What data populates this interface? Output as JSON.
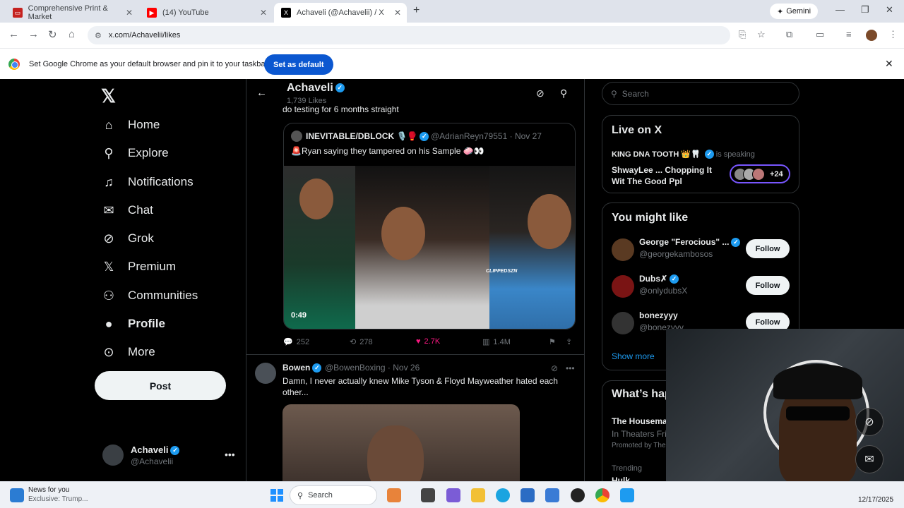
{
  "browser": {
    "tabs": [
      {
        "title": "Comprehensive Print & Market",
        "color": "#c5221f"
      },
      {
        "title": "(14) YouTube",
        "color": "#ff0000"
      },
      {
        "title": "Achaveli (@Achavelii) / X",
        "color": "#000000"
      }
    ],
    "gemini_label": "Gemini",
    "url": "x.com/Achavelii/likes",
    "infobar_text": "Set Google Chrome as your default browser and pin it to your taskbar",
    "infobar_button": "Set as default"
  },
  "sidebar": {
    "items": [
      {
        "label": "Home",
        "icon": "home-icon",
        "glyph": "⌂"
      },
      {
        "label": "Explore",
        "icon": "search-icon",
        "glyph": "⚲"
      },
      {
        "label": "Notifications",
        "icon": "bell-icon",
        "glyph": "🔔"
      },
      {
        "label": "Chat",
        "icon": "mail-icon",
        "glyph": "✉"
      },
      {
        "label": "Grok",
        "icon": "grok-icon",
        "glyph": "⊘"
      },
      {
        "label": "Premium",
        "icon": "x-icon",
        "glyph": "𝕏"
      },
      {
        "label": "Communities",
        "icon": "people-icon",
        "glyph": "⚇"
      },
      {
        "label": "Profile",
        "icon": "person-icon",
        "glyph": "●"
      },
      {
        "label": "More",
        "icon": "more-icon",
        "glyph": "⋯"
      }
    ],
    "post_label": "Post",
    "account": {
      "name": "Achaveli",
      "handle": "@Achavelii"
    }
  },
  "header": {
    "title": "Achaveli",
    "likes_count": "1,739 Likes",
    "cutoff_text": "do testing for 6 months straight"
  },
  "quote_tweet": {
    "name": "INEVITABLE/DBLOCK",
    "handle": "@AdrianReyn79551",
    "date": "· Nov 27",
    "text": "🚨Ryan saying they tampered on his Sample 🧼👀",
    "duration": "0:49",
    "watermark": "CLIPPEDSZN"
  },
  "actions": {
    "replies": "252",
    "reposts": "278",
    "likes": "2.7K",
    "views": "1.4M"
  },
  "tweet2": {
    "name": "Bowen",
    "handle": "@BowenBoxing",
    "date": "· Nov 26",
    "text": "Damn, I never actually knew Mike Tyson & Floyd Mayweather hated each other..."
  },
  "right": {
    "search_placeholder": "Search",
    "live_title": "Live on X",
    "live_host": "KING DNA TOOTH 👑🦷",
    "live_speaking": "is speaking",
    "live_space": "ShwayLee ... Chopping It Wit The Good Ppl",
    "live_count": "+24",
    "might_like_title": "You might like",
    "suggestions": [
      {
        "name": "George \"Ferocious\" ...",
        "handle": "@georgekambosos",
        "follow": "Follow"
      },
      {
        "name": "Dubs✗",
        "handle": "@onlydubsX",
        "follow": "Follow"
      },
      {
        "name": "bonezyyy",
        "handle": "@bonezyyy",
        "follow": "Follow"
      }
    ],
    "show_more": "Show more",
    "happening_title": "What’s happening",
    "happening_item": "The Housemaid",
    "happening_sub": "In Theaters Friday",
    "happening_promo": "Promoted by The Housemaid",
    "trending_label": "Trending",
    "trending_item": "Hulk"
  },
  "taskbar": {
    "news_title": "News for you",
    "news_sub": "Exclusive: Trump...",
    "search": "Search",
    "date": "12/17/2025"
  }
}
